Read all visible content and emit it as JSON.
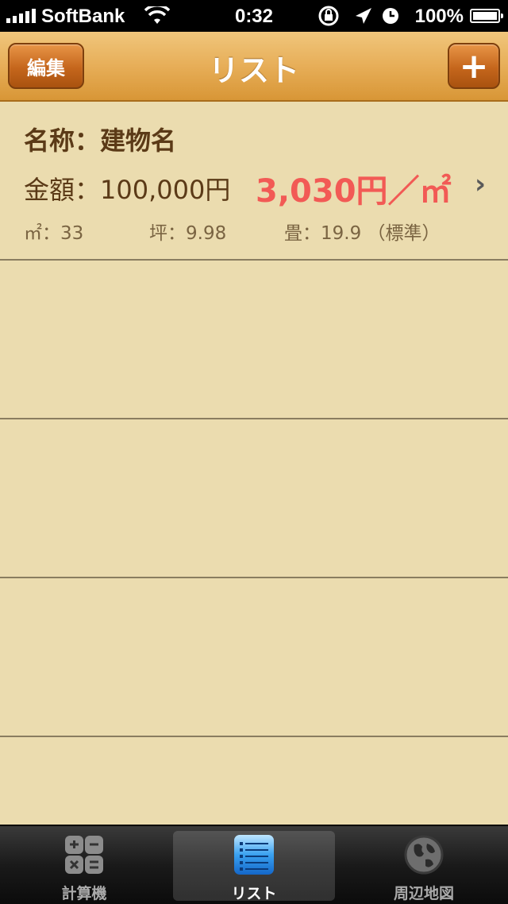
{
  "status_bar": {
    "carrier": "SoftBank",
    "time": "0:32",
    "battery": "100%"
  },
  "nav": {
    "title": "リスト",
    "edit_label": "編集",
    "add_label": "+"
  },
  "list": {
    "items": [
      {
        "name": "名称：建物名",
        "amount": "金額：100,000円",
        "unit_price": "3,030円／㎡",
        "m2": "㎡：33",
        "tsubo": "坪：9.98",
        "jou": "畳：19.9 （標準）"
      }
    ]
  },
  "tabs": [
    {
      "label": "計算機",
      "icon": "calculator-icon"
    },
    {
      "label": "リスト",
      "icon": "list-icon"
    },
    {
      "label": "周辺地図",
      "icon": "globe-icon"
    }
  ],
  "colors": {
    "background": "#ebdcaf",
    "nav_orange": "#e7ae58",
    "unit_price_red": "#f25a55",
    "text_brown": "#5b3a17"
  }
}
